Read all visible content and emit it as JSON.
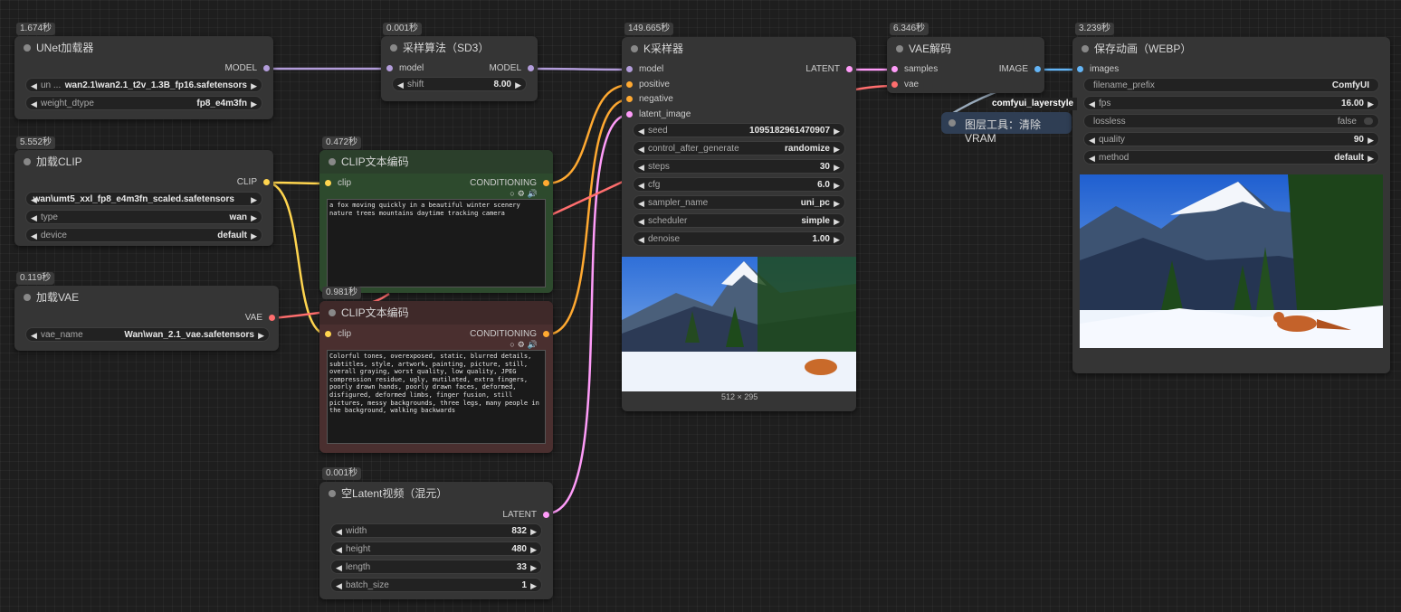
{
  "colors": {
    "model": "#b39ddb",
    "clip": "#ffd54f",
    "conditioning": "#ffa931",
    "vae": "#ff6e6e",
    "latent": "#ff9cf9",
    "image": "#64b5f6"
  },
  "unet": {
    "time": "1.674秒",
    "title": "UNet加载器",
    "out_model": "MODEL",
    "w1_label": "un ...",
    "w1_value": "wan2.1\\wan2.1_t2v_1.3B_fp16.safetensors",
    "w2_label": "weight_dtype",
    "w2_value": "fp8_e4m3fn"
  },
  "clipload": {
    "time": "5.552秒",
    "title": "加载CLIP",
    "out_clip": "CLIP",
    "w1_value": "wan\\umt5_xxl_fp8_e4m3fn_scaled.safetensors",
    "w2_label": "type",
    "w2_value": "wan",
    "w3_label": "device",
    "w3_value": "default"
  },
  "vaeload": {
    "time": "0.119秒",
    "title": "加载VAE",
    "out_vae": "VAE",
    "w1_label": "vae_name",
    "w1_value": "Wan\\wan_2.1_vae.safetensors"
  },
  "sd3": {
    "time": "0.001秒",
    "title": "采样算法（SD3）",
    "in_model": "model",
    "out_model": "MODEL",
    "w1_label": "shift",
    "w1_value": "8.00"
  },
  "clipenc1": {
    "time": "0.472秒",
    "title": "CLIP文本编码",
    "in_clip": "clip",
    "out_cond": "CONDITIONING",
    "text": "a fox moving quickly in a beautiful winter scenery nature trees mountains daytime tracking camera"
  },
  "clipenc2": {
    "time": "0.981秒",
    "title": "CLIP文本编码",
    "in_clip": "clip",
    "out_cond": "CONDITIONING",
    "text": "Colorful tones, overexposed, static, blurred details, subtitles, style, artwork, painting, picture, still, overall graying, worst quality, low quality, JPEG compression residue, ugly, mutilated, extra fingers, poorly drawn hands, poorly drawn faces, deformed, disfigured, deformed limbs, finger fusion, still pictures, messy backgrounds, three legs, many people in the background, walking backwards"
  },
  "latent": {
    "time": "0.001秒",
    "title": "空Latent视频（混元）",
    "out_latent": "LATENT",
    "widgets": [
      {
        "label": "width",
        "value": "832"
      },
      {
        "label": "height",
        "value": "480"
      },
      {
        "label": "length",
        "value": "33"
      },
      {
        "label": "batch_size",
        "value": "1"
      }
    ]
  },
  "ksampler": {
    "time": "149.665秒",
    "title": "K采样器",
    "in_model": "model",
    "in_positive": "positive",
    "in_negative": "negative",
    "in_latent": "latent_image",
    "out_latent": "LATENT",
    "widgets": [
      {
        "label": "seed",
        "value": "1095182961470907"
      },
      {
        "label": "control_after_generate",
        "value": "randomize"
      },
      {
        "label": "steps",
        "value": "30"
      },
      {
        "label": "cfg",
        "value": "6.0"
      },
      {
        "label": "sampler_name",
        "value": "uni_pc"
      },
      {
        "label": "scheduler",
        "value": "simple"
      },
      {
        "label": "denoise",
        "value": "1.00"
      }
    ],
    "dims": "512 × 295"
  },
  "vaedec": {
    "time": "6.346秒",
    "title": "VAE解码",
    "in_samples": "samples",
    "in_vae": "vae",
    "out_image": "IMAGE"
  },
  "vram": {
    "tag": "comfyui_layerstyle",
    "title": "图层工具：清除VRAM"
  },
  "save": {
    "time": "3.239秒",
    "title": "保存动画（WEBP）",
    "in_images": "images",
    "widgets": [
      {
        "label": "filename_prefix",
        "value": "ComfyUI"
      },
      {
        "label": "fps",
        "value": "16.00"
      },
      {
        "label": "lossless",
        "value": "false"
      },
      {
        "label": "quality",
        "value": "90"
      },
      {
        "label": "method",
        "value": "default"
      }
    ]
  }
}
